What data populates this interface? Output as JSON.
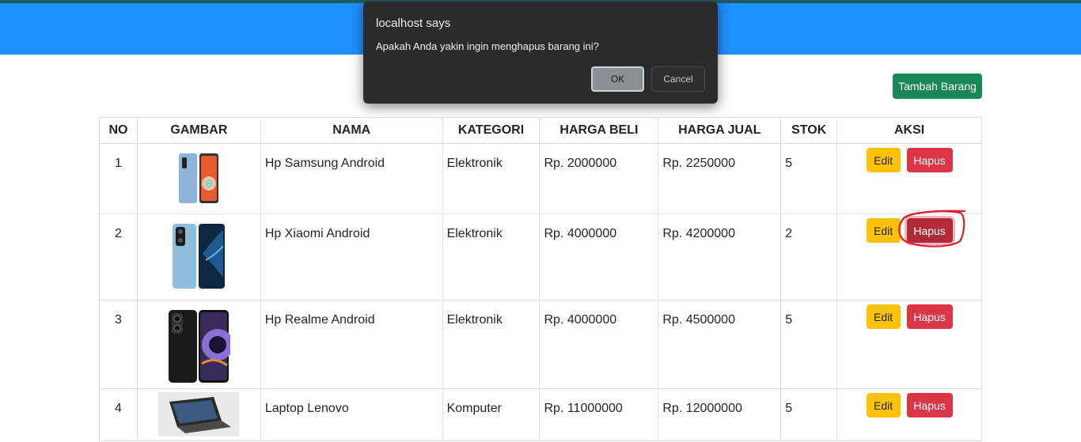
{
  "toolbar": {
    "add_label": "Tambah Barang"
  },
  "table": {
    "headers": [
      "NO",
      "GAMBAR",
      "NAMA",
      "KATEGORI",
      "HARGA BELI",
      "HARGA JUAL",
      "STOK",
      "AKSI"
    ],
    "rows": [
      {
        "no": "1",
        "image": "samsung-phone-image",
        "nama": "Hp Samsung Android",
        "kategori": "Elektronik",
        "harga_beli": "Rp. 2000000",
        "harga_jual": "Rp. 2250000",
        "stok": "5"
      },
      {
        "no": "2",
        "image": "xiaomi-phone-image",
        "nama": "Hp Xiaomi Android",
        "kategori": "Elektronik",
        "harga_beli": "Rp. 4000000",
        "harga_jual": "Rp. 4200000",
        "stok": "2"
      },
      {
        "no": "3",
        "image": "realme-phone-image",
        "nama": "Hp Realme Android",
        "kategori": "Elektronik",
        "harga_beli": "Rp. 4000000",
        "harga_jual": "Rp. 4500000",
        "stok": "5"
      },
      {
        "no": "4",
        "image": "lenovo-laptop-image",
        "nama": "Laptop Lenovo",
        "kategori": "Komputer",
        "harga_beli": "Rp. 11000000",
        "harga_jual": "Rp. 12000000",
        "stok": "5"
      }
    ],
    "edit_label": "Edit",
    "delete_label": "Hapus"
  },
  "dialog": {
    "title": "localhost says",
    "message": "Apakah Anda yakin ingin menghapus barang ini?",
    "ok_label": "OK",
    "cancel_label": "Cancel"
  },
  "colors": {
    "header": "#1e90ff",
    "add_button": "#198754",
    "edit_button": "#ffc107",
    "delete_button": "#dc3545",
    "annotation": "#e01e2a"
  }
}
